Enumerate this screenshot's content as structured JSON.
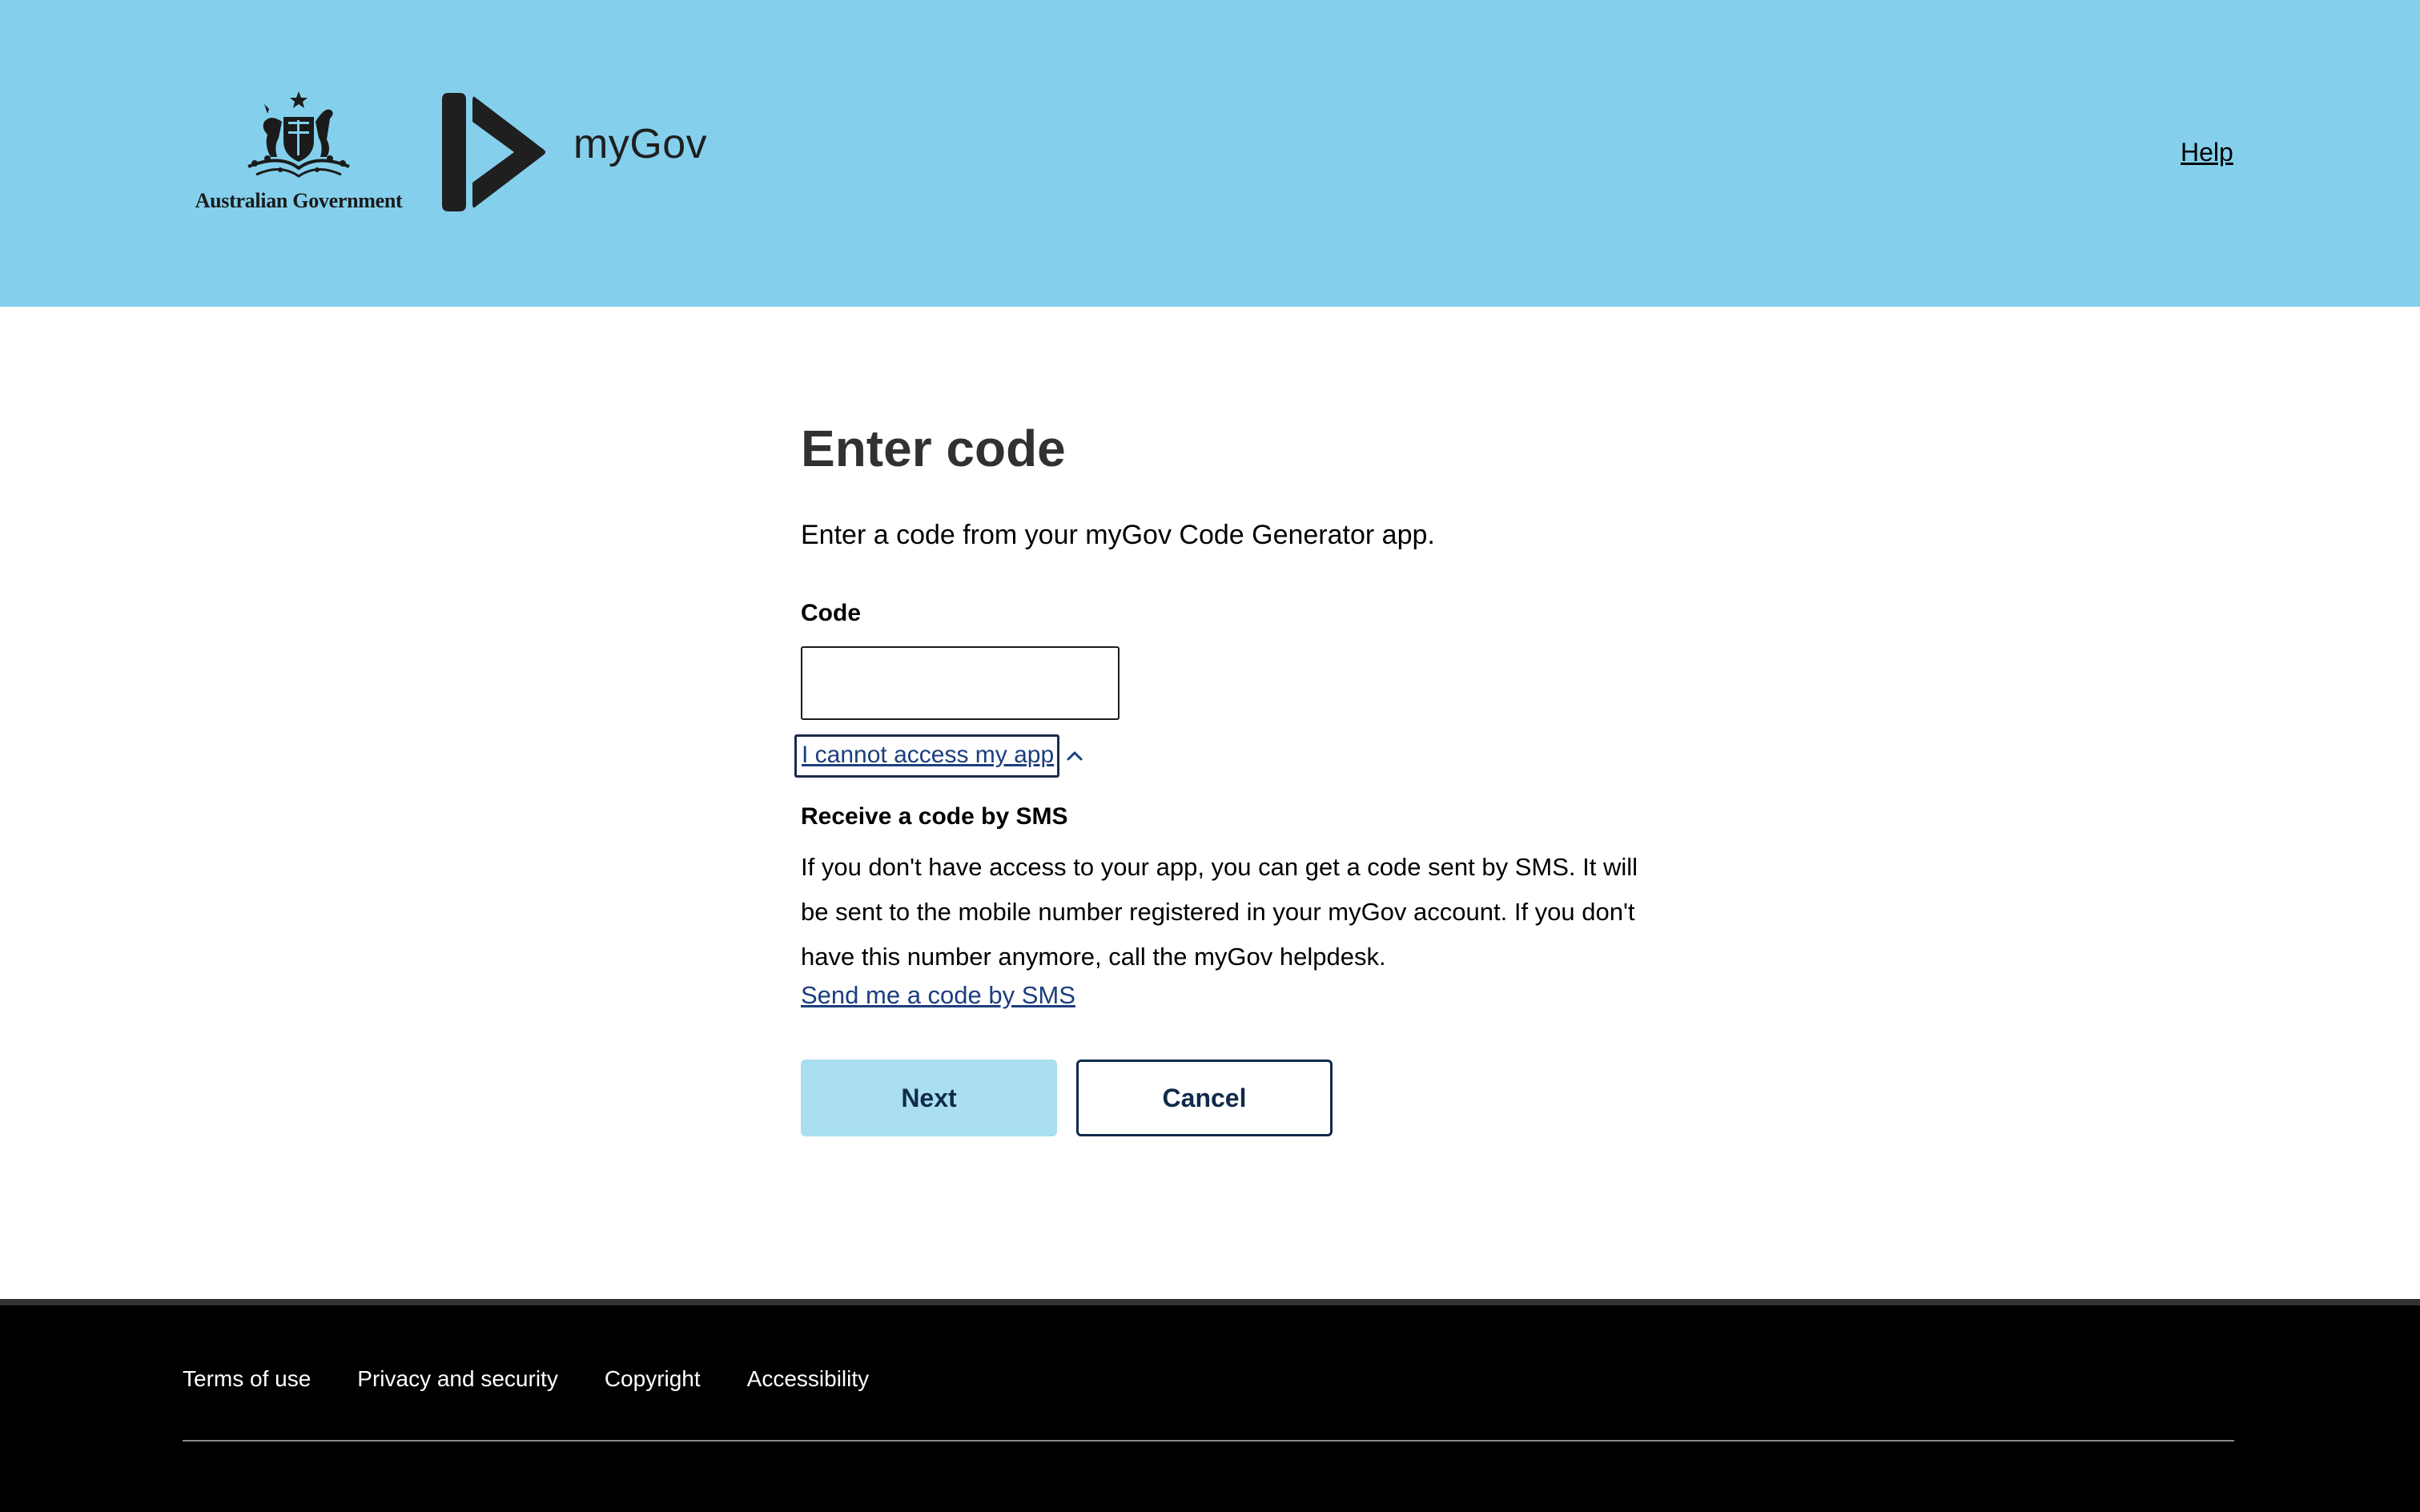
{
  "header": {
    "gov_name": "Australian Government",
    "brand": "myGov",
    "help_label": "Help"
  },
  "main": {
    "title": "Enter code",
    "intro": "Enter a code from your myGov Code Generator app.",
    "code_label": "Code",
    "code_value": "",
    "toggle_label": "I cannot access my app",
    "sms_heading": "Receive a code by SMS",
    "sms_body": "If you don't have access to your app, you can get a code sent by SMS. It will be sent to the mobile number registered in your myGov account. If you don't have this number anymore, call the myGov helpdesk.",
    "sms_link": "Send me a code by SMS",
    "next_label": "Next",
    "cancel_label": "Cancel"
  },
  "footer": {
    "links": [
      "Terms of use",
      "Privacy and security",
      "Copyright",
      "Accessibility"
    ]
  },
  "colors": {
    "header_bg": "#84d0ec",
    "link": "#1b3e7e",
    "button_primary_bg": "#a9dff0",
    "button_text": "#112a4a",
    "footer_bg": "#000000"
  },
  "icons": {
    "gov_crest": "coat-of-arms-icon",
    "brand_mark": "mygov-logo-icon",
    "toggle": "chevron-up-icon"
  }
}
